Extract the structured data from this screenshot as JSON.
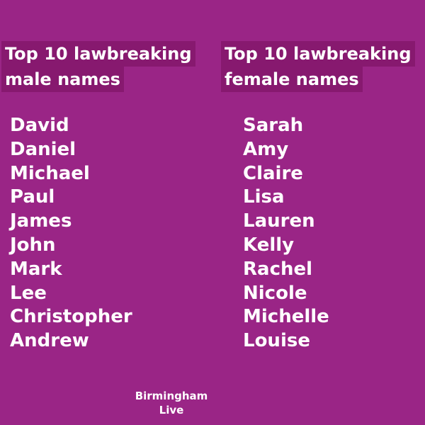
{
  "theme": {
    "background": "#9a2586",
    "highlight": "#87196f",
    "text": "#ffffff"
  },
  "male": {
    "heading_line1": "Top 10 lawbreaking",
    "heading_line2": "male names",
    "names": [
      "David",
      "Daniel",
      "Michael",
      "Paul",
      "James",
      "John",
      "Mark",
      "Lee",
      "Christopher",
      "Andrew"
    ]
  },
  "female": {
    "heading_line1": "Top 10 lawbreaking",
    "heading_line2": "female names",
    "names": [
      "Sarah",
      "Amy",
      "Claire",
      "Lisa",
      "Lauren",
      "Kelly",
      "Rachel",
      "Nicole",
      "Michelle",
      "Louise"
    ]
  },
  "brand": {
    "line1": "Birmingham",
    "line2": "Live"
  }
}
